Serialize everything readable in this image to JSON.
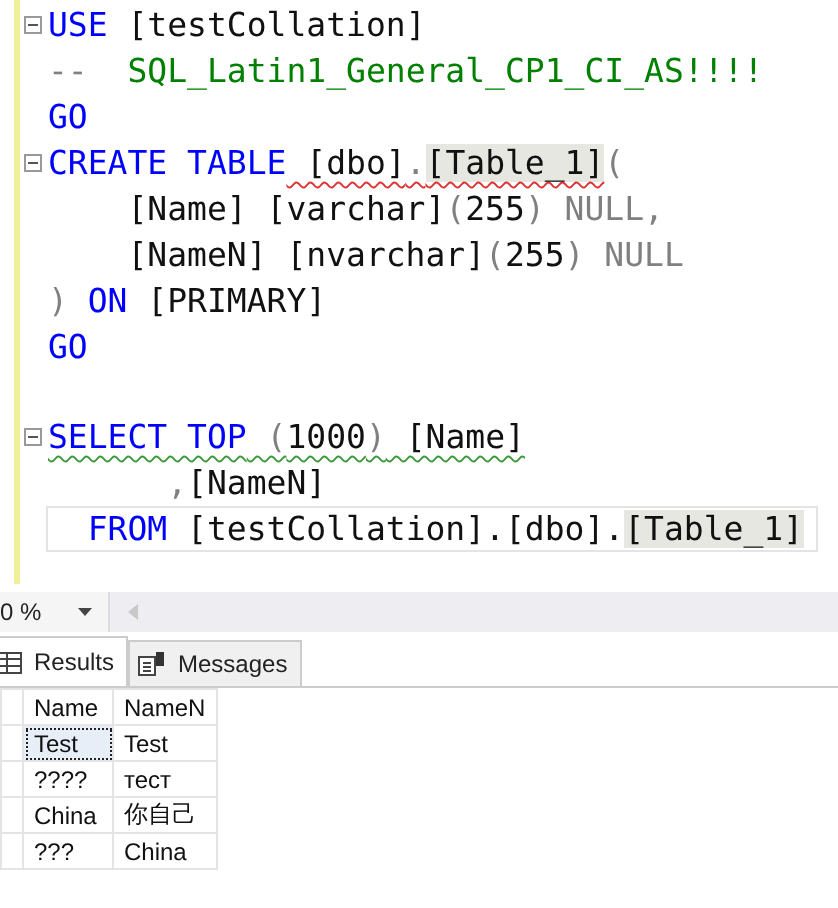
{
  "editor": {
    "blocks": [
      {
        "lines": [
          {
            "fold": true,
            "tokens": [
              {
                "text": "USE",
                "kind": "keyword"
              },
              {
                "text": " [testCollation]",
                "kind": "text"
              }
            ]
          },
          {
            "tokens": [
              {
                "text": "--",
                "kind": "gray"
              },
              {
                "text": "  SQL_Latin1_General_CP1_CI_AS!!!!",
                "kind": "comment"
              }
            ]
          },
          {
            "tokens": [
              {
                "text": "GO",
                "kind": "keyword"
              }
            ]
          },
          {
            "fold": true,
            "tokens": [
              {
                "text": "CREATE TABLE",
                "kind": "keyword"
              },
              {
                "text": " [dbo]",
                "kind": "text",
                "error": true
              },
              {
                "text": ".",
                "kind": "gray",
                "error": true
              },
              {
                "text": "[Table_1]",
                "kind": "text",
                "error": true,
                "highlight": true
              },
              {
                "text": "(",
                "kind": "gray"
              }
            ]
          },
          {
            "tokens": [
              {
                "text": "    [Name] [varchar]",
                "kind": "text"
              },
              {
                "text": "(",
                "kind": "gray"
              },
              {
                "text": "255",
                "kind": "text"
              },
              {
                "text": ")",
                "kind": "gray"
              },
              {
                "text": " NULL,",
                "kind": "gray"
              }
            ]
          },
          {
            "tokens": [
              {
                "text": "    [NameN] [nvarchar]",
                "kind": "text"
              },
              {
                "text": "(",
                "kind": "gray"
              },
              {
                "text": "255",
                "kind": "text"
              },
              {
                "text": ")",
                "kind": "gray"
              },
              {
                "text": " NULL",
                "kind": "gray"
              }
            ]
          },
          {
            "tokens": [
              {
                "text": ")",
                "kind": "gray"
              },
              {
                "text": " ON",
                "kind": "keyword"
              },
              {
                "text": " [PRIMARY]",
                "kind": "text"
              }
            ]
          },
          {
            "tokens": [
              {
                "text": "GO",
                "kind": "keyword"
              }
            ]
          }
        ]
      },
      {
        "lines": [
          {
            "fold": true,
            "tokens": [
              {
                "text": "SELECT TOP",
                "kind": "keyword",
                "warning": true
              },
              {
                "text": " (",
                "kind": "gray",
                "warning": true
              },
              {
                "text": "1000",
                "kind": "text",
                "warning": true
              },
              {
                "text": ")",
                "kind": "gray",
                "warning": true
              },
              {
                "text": " [Name]",
                "kind": "text",
                "warning": true
              }
            ]
          },
          {
            "tokens": [
              {
                "text": "      ,",
                "kind": "gray"
              },
              {
                "text": "[NameN]",
                "kind": "text"
              }
            ]
          },
          {
            "current": true,
            "tokens": [
              {
                "text": "  FROM",
                "kind": "keyword"
              },
              {
                "text": " [testCollation].[dbo].",
                "kind": "text"
              },
              {
                "text": "[Table_1]",
                "kind": "text",
                "highlight": true
              }
            ]
          }
        ]
      }
    ]
  },
  "zoom": {
    "value": "0 %"
  },
  "tabs": [
    {
      "label": "Results",
      "selected": true
    },
    {
      "label": "Messages",
      "selected": false
    }
  ],
  "grid": {
    "columns": [
      "Name",
      "NameN"
    ],
    "rows": [
      {
        "cells": [
          {
            "text": "Test",
            "focused": true
          },
          {
            "text": "Test",
            "focused": false
          }
        ]
      },
      {
        "cells": [
          {
            "text": "????",
            "focused": false
          },
          {
            "text": "тест",
            "focused": false
          }
        ]
      },
      {
        "cells": [
          {
            "text": "China",
            "focused": false
          },
          {
            "text": "你自己",
            "focused": false
          }
        ]
      },
      {
        "cells": [
          {
            "text": "???",
            "focused": false
          },
          {
            "text": "China",
            "focused": false
          }
        ]
      }
    ]
  }
}
